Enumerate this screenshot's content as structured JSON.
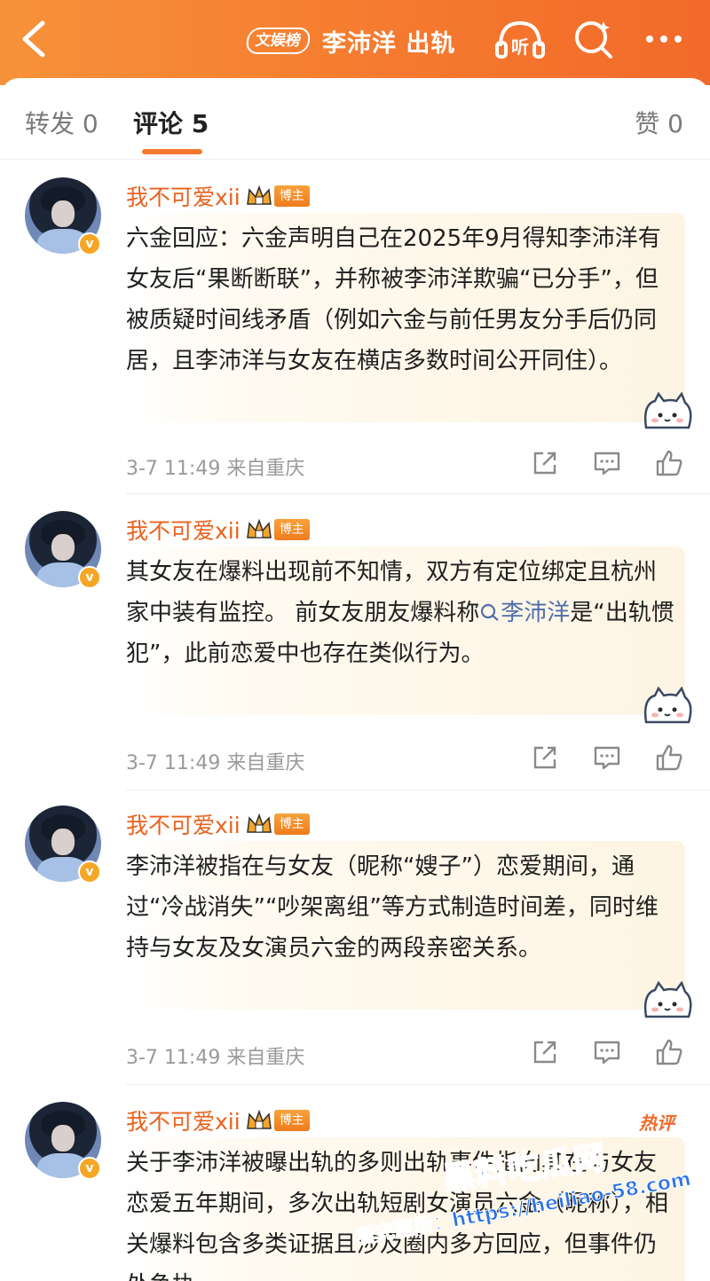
{
  "header": {
    "topic_tag": "文娱榜",
    "title": "李沛洋 出轨",
    "listen_label": "听",
    "colors": {
      "header_gradient_start": "#f7923a",
      "header_gradient_end": "#f26a2a"
    }
  },
  "tabs": {
    "repost": "转发 0",
    "comments": "评论 5",
    "likes": "赞 0",
    "active": "comments",
    "accent": "#f57a2f"
  },
  "comments": [
    {
      "username": "我不可爱xii",
      "badge": "博主",
      "text": "六金回应：六金声明自己在2025年9月得知李沛洋有女友后“果断断联”，并称被李沛洋欺骗“已分手”，但被质疑时间线矛盾（例如六金与前任男友分手后仍同居，且李沛洋与女友在横店多数时间公开同住）。",
      "meta": "3-7 11:49 来自重庆"
    },
    {
      "username": "我不可爱xii",
      "badge": "博主",
      "text_before": "其女友在爆料出现前不知情，双方有定位绑定且杭州家中装有监控。 前女友朋友爆料称",
      "link": "李沛洋",
      "text_after": "是“出轨惯犯”，此前恋爱中也存在类似行为。",
      "meta": "3-7 11:49 来自重庆"
    },
    {
      "username": "我不可爱xii",
      "badge": "博主",
      "text": "李沛洋被指在与女友（昵称“嫂子”）恋爱期间，通过“冷战消失”“吵架离组”等方式制造时间差，同时维持与女友及女演员六金的两段亲密关系。",
      "meta": "3-7 11:49 来自重庆"
    },
    {
      "username": "我不可爱xii",
      "badge": "博主",
      "hot_tag": "热评",
      "text": "关于李沛洋被曝出轨的多则出轨事件指向其在与女友恋爱五年期间，多次出轨短剧女演员六金（昵称），相关爆料包含多类证据且涉及圈内多方回应，但事件仍处争执",
      "meta": ""
    }
  ],
  "watermark": {
    "line1": "黑料吃瓜网",
    "line2": "看完整版：https://heiliao-58.com"
  },
  "icons": [
    "back-icon",
    "listen-icon",
    "search-icon",
    "more-icon",
    "share-icon",
    "comment-icon",
    "like-icon",
    "crown-icon",
    "verified-icon",
    "mascot-icon"
  ]
}
